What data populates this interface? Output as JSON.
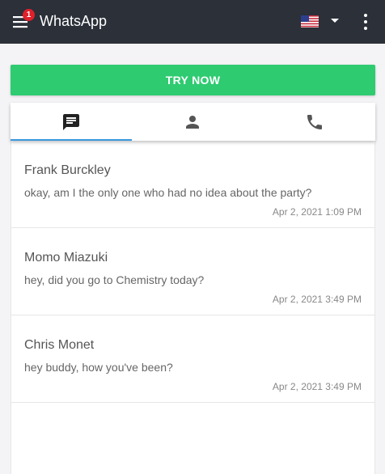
{
  "appbar": {
    "menu_icon": "menu-icon",
    "notification_count": "1",
    "title": "WhatsApp",
    "flag_icon": "us-flag-icon",
    "dropdown_icon": "caret-down-icon",
    "more_icon": "more-vert-icon",
    "background_color": "#2b3039"
  },
  "cta": {
    "label": "TRY NOW",
    "color": "#2ecb71"
  },
  "tabs": [
    {
      "icon": "chat-icon",
      "active": true
    },
    {
      "icon": "person-icon",
      "active": false
    },
    {
      "icon": "phone-icon",
      "active": false
    }
  ],
  "accent_color": "#3a98dc",
  "chats": [
    {
      "name": "Frank Burckley",
      "message": "okay, am I the only one who had no idea about the party?",
      "time": "Apr 2, 2021 1:09 PM"
    },
    {
      "name": "Momo Miazuki",
      "message": "hey, did you go to Chemistry today?",
      "time": "Apr 2, 2021 3:49 PM"
    },
    {
      "name": "Chris Monet",
      "message": "hey buddy, how you've been?",
      "time": "Apr 2, 2021 3:49 PM"
    }
  ]
}
